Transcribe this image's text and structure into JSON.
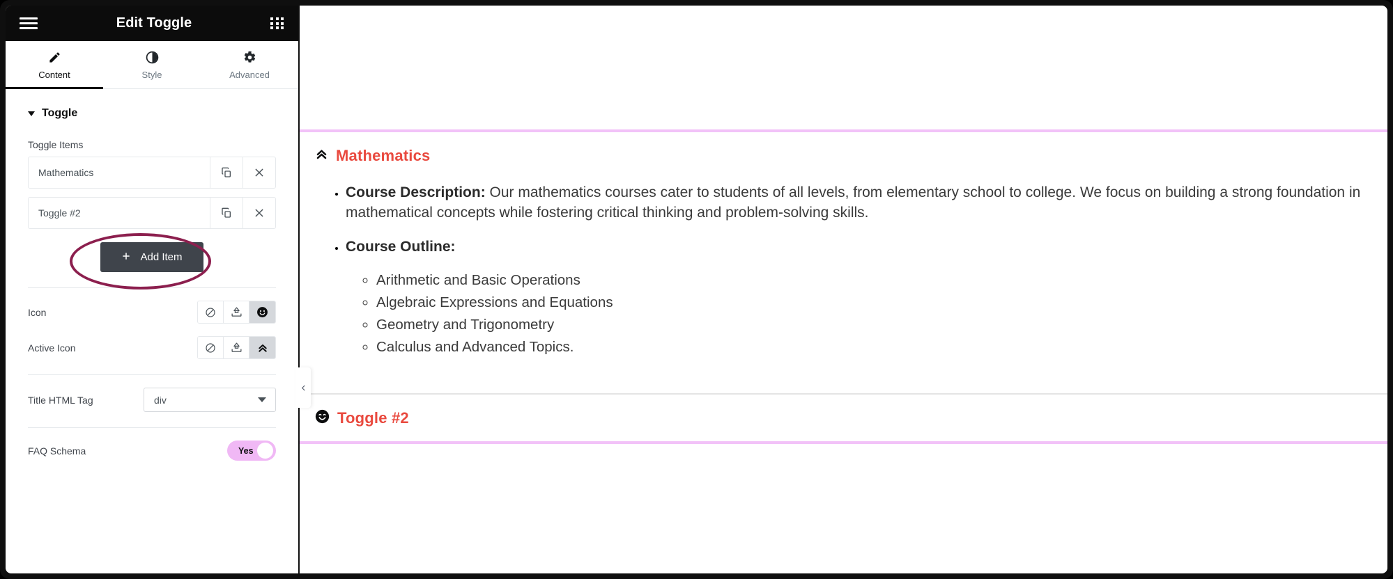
{
  "panel": {
    "header": {
      "title": "Edit Toggle",
      "menu_icon": "hamburger-icon",
      "apps_icon": "grid-icon"
    },
    "tabs": [
      {
        "label": "Content",
        "icon": "pencil-icon",
        "active": true
      },
      {
        "label": "Style",
        "icon": "contrast-half-circle-icon",
        "active": false
      },
      {
        "label": "Advanced",
        "icon": "gear-icon",
        "active": false
      }
    ],
    "section": {
      "title": "Toggle",
      "collapsed": false
    },
    "toggle_items": {
      "label": "Toggle Items",
      "items": [
        {
          "title": "Mathematics",
          "duplicate_icon": "copy-icon",
          "remove_icon": "close-icon"
        },
        {
          "title": "Toggle #2",
          "duplicate_icon": "copy-icon",
          "remove_icon": "close-icon"
        }
      ],
      "add_label": "Add Item",
      "add_icon": "plus-icon",
      "highlight_color": "#8c1f4e"
    },
    "controls": [
      {
        "label": "Icon",
        "choices": [
          {
            "icon": "ban-none-icon",
            "selected": false
          },
          {
            "icon": "upload-svg-icon",
            "selected": false
          },
          {
            "icon": "smiley-icon",
            "selected": true
          }
        ]
      },
      {
        "label": "Active Icon",
        "choices": [
          {
            "icon": "ban-none-icon",
            "selected": false
          },
          {
            "icon": "upload-svg-icon",
            "selected": false
          },
          {
            "icon": "chevron-double-up-icon",
            "selected": true
          }
        ]
      }
    ],
    "title_html_tag": {
      "label": "Title HTML Tag",
      "value": "div",
      "caret_icon": "chevron-down-icon"
    },
    "faq_schema": {
      "label": "FAQ Schema",
      "value": "Yes",
      "on": true,
      "track_color": "#f0b8f5"
    }
  },
  "collapse_tab": {
    "icon": "chevron-left-icon"
  },
  "content": {
    "divider_color": "#f2c2f8",
    "toggles": [
      {
        "title": "Mathematics",
        "title_color": "#e94a3f",
        "icon": "chevron-double-up-icon",
        "open": true,
        "blocks": [
          {
            "lead": "Course Description:",
            "text": " Our mathematics courses cater to students of all levels, from elementary school to college. We focus on building a strong foundation in mathematical concepts while fostering critical thinking and problem-solving skills."
          },
          {
            "lead": "Course Outline:",
            "text": "",
            "sub_items": [
              "Arithmetic and Basic Operations",
              "Algebraic Expressions and Equations",
              "Geometry and Trigonometry",
              "Calculus and Advanced Topics."
            ]
          }
        ]
      },
      {
        "title": "Toggle #2",
        "title_color": "#e94a3f",
        "icon": "smiley-icon",
        "open": false,
        "blocks": []
      }
    ]
  }
}
